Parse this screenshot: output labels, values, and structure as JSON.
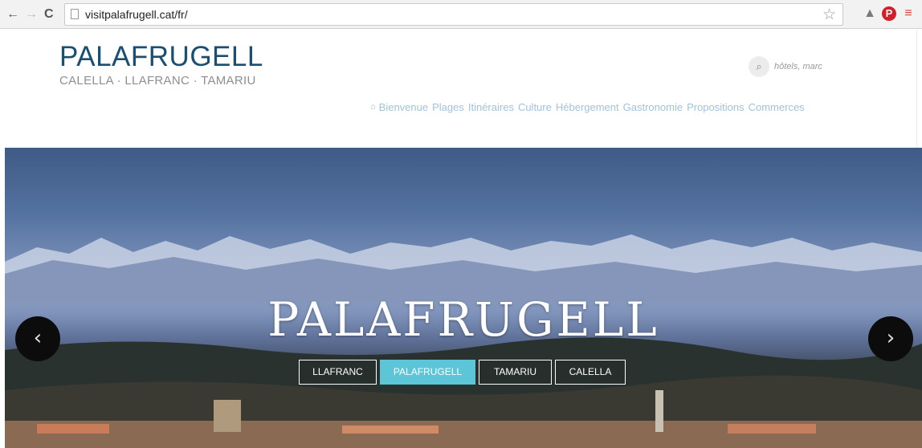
{
  "browser": {
    "back_icon": "←",
    "forward_icon": "→",
    "reload_icon": "C",
    "url": "visitpalafrugell.cat/fr/",
    "star_icon": "☆",
    "pinterest_icon": "P",
    "menu_icon": "≡",
    "extension_icon": "▲"
  },
  "header": {
    "title": "PALAFRUGELL",
    "subtitle": "CALELLA · LLAFRANC · TAMARIU",
    "search_icon": "⌕",
    "search_placeholder": "hôtels, marc",
    "home_icon": "⌂",
    "nav": [
      {
        "label": "Bienvenue"
      },
      {
        "label": "Plages"
      },
      {
        "label": "Itinéraires"
      },
      {
        "label": "Culture"
      },
      {
        "label": "Hébergement"
      },
      {
        "label": "Gastronomie"
      },
      {
        "label": "Propositions"
      },
      {
        "label": "Commerces"
      }
    ]
  },
  "hero": {
    "title": "PALAFRUGELL",
    "prev_icon": "‹",
    "next_icon": "›",
    "tabs": [
      {
        "label": "LLAFRANC",
        "active": false
      },
      {
        "label": "PALAFRUGELL",
        "active": true
      },
      {
        "label": "TAMARIU",
        "active": false
      },
      {
        "label": "CALELLA",
        "active": false
      }
    ]
  },
  "colors": {
    "brand": "#1a4f73",
    "nav_link": "#9fc3dd",
    "active_tab": "#5cc6d8",
    "pinterest": "#d21f2c"
  }
}
